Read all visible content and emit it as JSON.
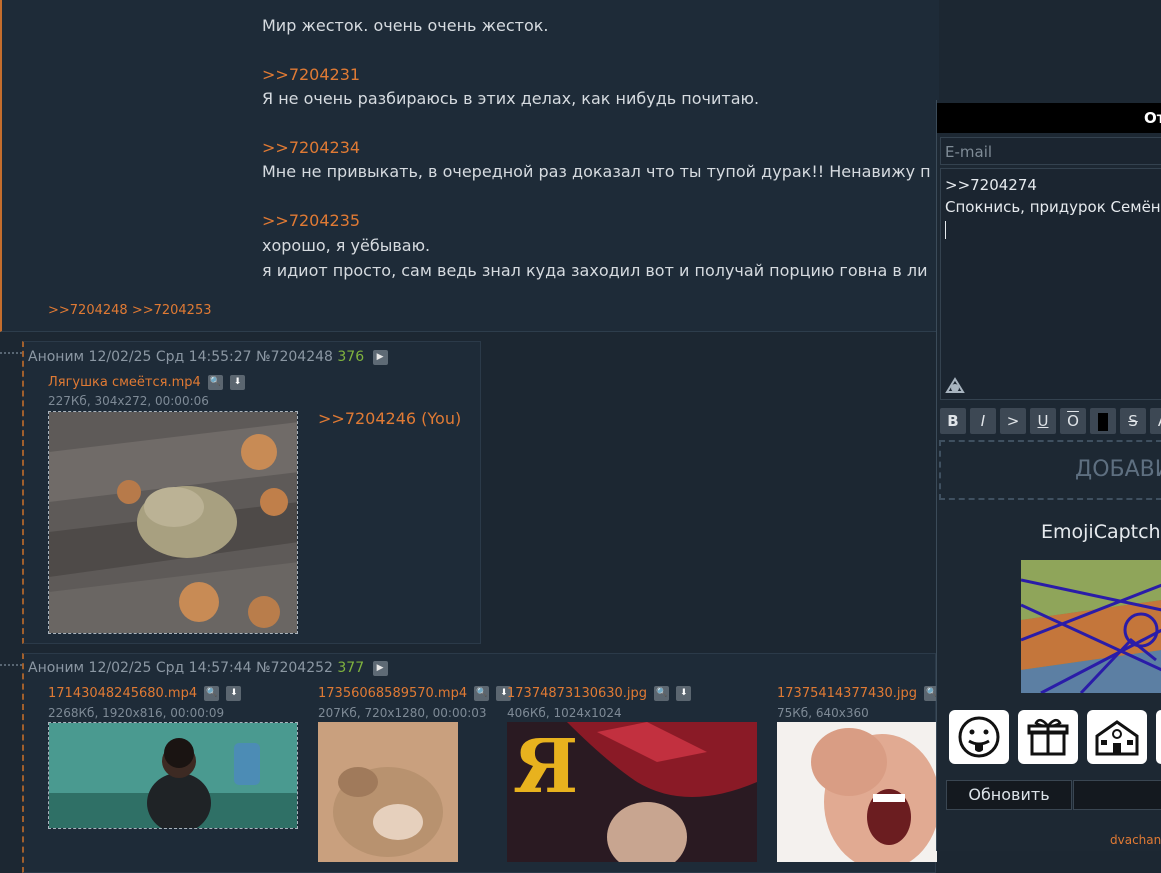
{
  "post1": {
    "lines": [
      "Мир жесток. очень очень жесток.",
      ">>7204231",
      "Я не очень разбираюсь в этих делах, как нибудь почитаю.",
      ">>7204234",
      "Мне не привыкать, в очередной раз доказал что ты тупой дурак!! Ненавижу п",
      ">>7204235",
      "хорошо, я уёбываю.",
      "я идиот просто, сам ведь знал куда заходил вот и получай порцию говна в ли"
    ],
    "replies": ">>7204248 >>7204253"
  },
  "post2": {
    "header": "Аноним  12/02/25 Срд 14:55:27 №7204248",
    "count": "376",
    "file": {
      "name": "Лягушка смеётся.mp4",
      "info": "227Кб, 304x272, 00:00:06"
    },
    "reply_text": ">>7204246 (You)"
  },
  "post3": {
    "header": "Аноним  12/02/25 Срд 14:57:44 №7204252",
    "count": "377",
    "files": [
      {
        "name": "17143048245680.mp4",
        "info": "2268Кб, 1920x816, 00:00:09"
      },
      {
        "name": "17356068589570.mp4",
        "info": "207Кб, 720x1280, 00:00:03"
      },
      {
        "name": "17374873130630.jpg",
        "info": "406Кб, 1024x1024"
      },
      {
        "name": "17375414377430.jpg",
        "info": "75Кб, 640x360"
      }
    ]
  },
  "panel": {
    "title": "От",
    "email_placeholder": "E-mail",
    "message_line1": ">>7204274",
    "message_line2": "Спокнись, придурок Семён.",
    "format_buttons": [
      "B",
      "I",
      ">",
      "U",
      "O",
      "",
      "S",
      "A"
    ],
    "add_button": "ДОБАВИ",
    "captcha_title": "EmojiCaptcha",
    "emoji_icons": [
      "tongue-face-icon",
      "gift-icon",
      "school-icon"
    ],
    "refresh_label": "Обновить",
    "footer": "dvachan"
  }
}
